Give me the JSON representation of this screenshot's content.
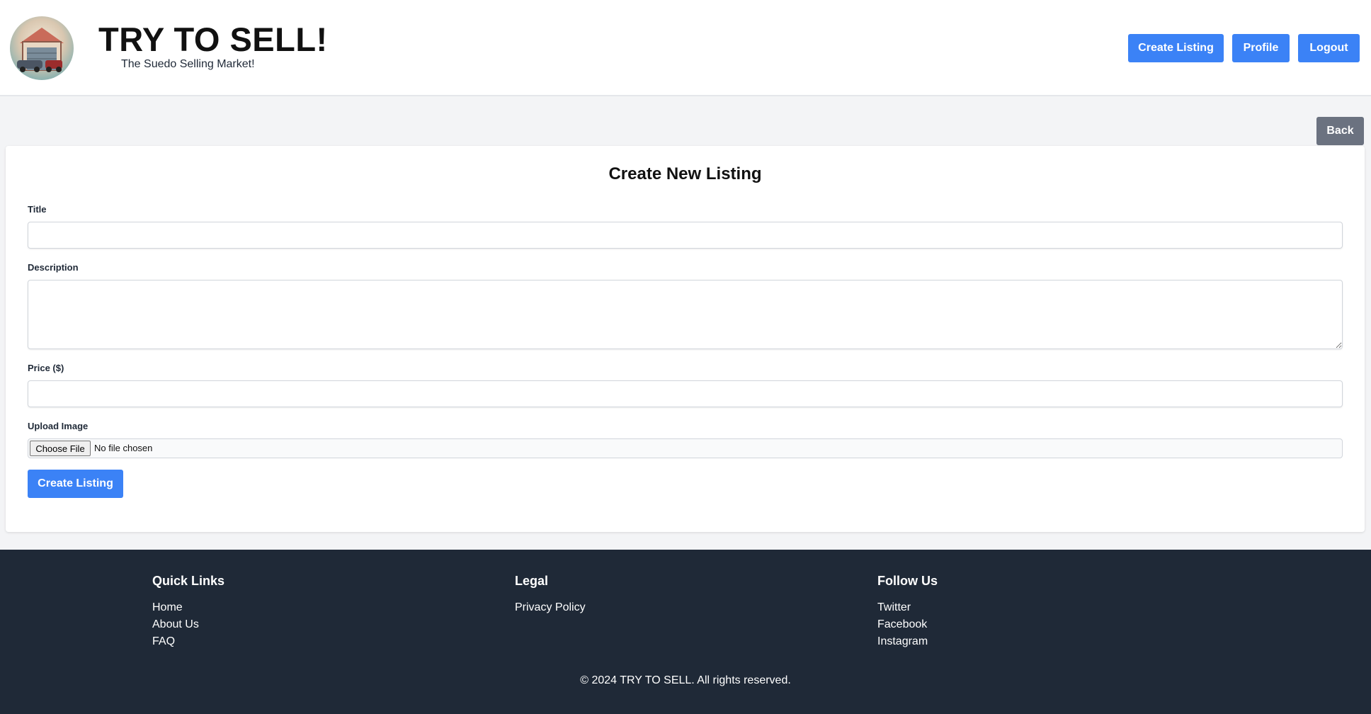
{
  "header": {
    "title": "TRY TO SELL!",
    "tagline": "The Suedo Selling Market!",
    "nav": {
      "create_listing": "Create Listing",
      "profile": "Profile",
      "logout": "Logout"
    }
  },
  "back_label": "Back",
  "form": {
    "heading": "Create New Listing",
    "title_label": "Title",
    "title_value": "",
    "description_label": "Description",
    "description_value": "",
    "price_label": "Price ($)",
    "price_value": "",
    "image_label": "Upload Image",
    "file_button": "Choose File",
    "file_status": "No file chosen",
    "submit_label": "Create Listing"
  },
  "footer": {
    "quick_links": {
      "heading": "Quick Links",
      "links": [
        "Home",
        "About Us",
        "FAQ"
      ]
    },
    "legal": {
      "heading": "Legal",
      "links": [
        "Privacy Policy"
      ]
    },
    "follow": {
      "heading": "Follow Us",
      "links": [
        "Twitter",
        "Facebook",
        "Instagram"
      ]
    },
    "copyright": "© 2024 TRY TO SELL. All rights reserved."
  },
  "colors": {
    "primary": "#3b82f6",
    "secondary": "#6b7280",
    "footer_bg": "#1f2937",
    "page_bg": "#f3f4f6"
  }
}
